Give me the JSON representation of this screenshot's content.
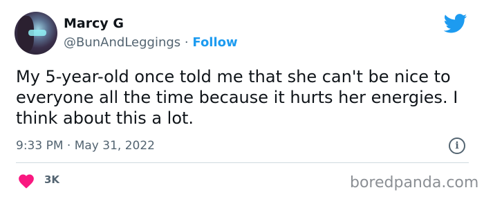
{
  "author": {
    "display_name": "Marcy G",
    "handle": "@BunAndLeggings",
    "separator": "·",
    "follow_label": "Follow"
  },
  "tweet": {
    "text": "My 5-year-old once told me that she can't be nice to everyone all the time because it hurts her energies. I think about this a lot.",
    "time": "9:33 PM",
    "date_separator": "·",
    "date": "May 31, 2022"
  },
  "engagement": {
    "likes": "3K"
  },
  "watermark": "boredpanda.com",
  "colors": {
    "accent": "#1d9bf0",
    "heart": "#f91880",
    "secondary_text": "#536471",
    "divider": "#cfd9de"
  },
  "icons": {
    "brand": "twitter-bird-icon",
    "info": "info-icon",
    "like": "heart-icon"
  }
}
